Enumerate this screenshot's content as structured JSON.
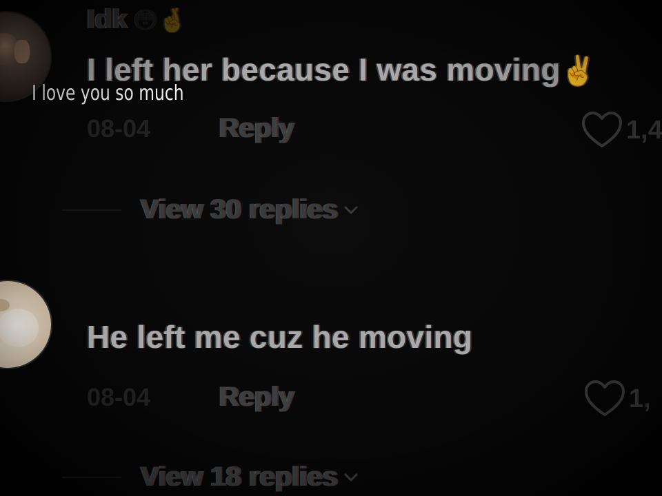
{
  "comments": [
    {
      "username": "Idk",
      "username_emoji": "😳🤞",
      "text": "I left her because I was moving",
      "text_emoji": "✌️",
      "date": "08-04",
      "reply_label": "Reply",
      "like_count": "1,4",
      "view_replies_label": "View 30 replies",
      "avatar_icon": "person-photo-avatar"
    },
    {
      "text": "He left me cuz he moving",
      "date": "08-04",
      "reply_label": "Reply",
      "like_count": "1,",
      "view_replies_label": "View 18 replies",
      "avatar_icon": "cat-photo-avatar"
    }
  ],
  "overlay_caption": "I love you so much",
  "icons": {
    "like": "heart-outline-icon",
    "expand": "chevron-down-icon"
  },
  "colors": {
    "background": "#050505",
    "comment_text": "#a8a8a8",
    "muted_text": "#3a3a3a",
    "emoji_accent": "#c99a63"
  }
}
